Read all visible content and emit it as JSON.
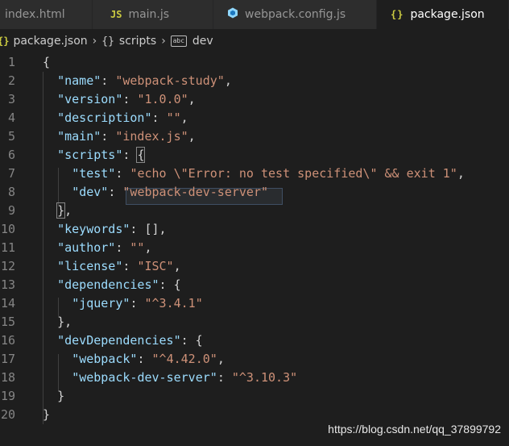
{
  "tabs": [
    {
      "label": "index.html",
      "icon": "html-file-icon"
    },
    {
      "label": "main.js",
      "icon": "js-file-icon",
      "icon_text": "JS"
    },
    {
      "label": "webpack.config.js",
      "icon": "webpack-cube-icon"
    },
    {
      "label": "package.json",
      "icon": "json-file-icon",
      "icon_text": "{}",
      "active": true
    }
  ],
  "breadcrumb": {
    "file": "package.json",
    "file_icon_text": "{}",
    "object_icon_text": "{}",
    "object": "scripts",
    "string_icon_text": "abc",
    "item": "dev"
  },
  "editor": {
    "lines": [
      {
        "n": "1",
        "parts": [
          [
            "p",
            "{"
          ]
        ]
      },
      {
        "n": "2",
        "parts": [
          [
            "k",
            "\"name\""
          ],
          [
            "p",
            ": "
          ],
          [
            "s",
            "\"webpack-study\""
          ],
          [
            "p",
            ","
          ]
        ]
      },
      {
        "n": "3",
        "parts": [
          [
            "k",
            "\"version\""
          ],
          [
            "p",
            ": "
          ],
          [
            "s",
            "\"1.0.0\""
          ],
          [
            "p",
            ","
          ]
        ]
      },
      {
        "n": "4",
        "parts": [
          [
            "k",
            "\"description\""
          ],
          [
            "p",
            ": "
          ],
          [
            "s",
            "\"\""
          ],
          [
            "p",
            ","
          ]
        ]
      },
      {
        "n": "5",
        "parts": [
          [
            "k",
            "\"main\""
          ],
          [
            "p",
            ": "
          ],
          [
            "s",
            "\"index.js\""
          ],
          [
            "p",
            ","
          ]
        ]
      },
      {
        "n": "6",
        "parts": [
          [
            "k",
            "\"scripts\""
          ],
          [
            "p",
            ": "
          ],
          [
            "p",
            "{"
          ]
        ]
      },
      {
        "n": "7",
        "parts": [
          [
            "k",
            "\"test\""
          ],
          [
            "p",
            ": "
          ],
          [
            "s",
            "\"echo \\\"Error: no test specified\\\" && exit 1\""
          ],
          [
            "p",
            ","
          ]
        ]
      },
      {
        "n": "8",
        "parts": [
          [
            "k",
            "\"dev\""
          ],
          [
            "p",
            ": "
          ],
          [
            "s",
            "\"webpack-dev-server\""
          ]
        ]
      },
      {
        "n": "9",
        "parts": [
          [
            "p",
            "}"
          ],
          [
            "p",
            ","
          ]
        ]
      },
      {
        "n": "10",
        "parts": [
          [
            "k",
            "\"keywords\""
          ],
          [
            "p",
            ": [],"
          ]
        ]
      },
      {
        "n": "11",
        "parts": [
          [
            "k",
            "\"author\""
          ],
          [
            "p",
            ": "
          ],
          [
            "s",
            "\"\""
          ],
          [
            "p",
            ","
          ]
        ]
      },
      {
        "n": "12",
        "parts": [
          [
            "k",
            "\"license\""
          ],
          [
            "p",
            ": "
          ],
          [
            "s",
            "\"ISC\""
          ],
          [
            "p",
            ","
          ]
        ]
      },
      {
        "n": "13",
        "parts": [
          [
            "k",
            "\"dependencies\""
          ],
          [
            "p",
            ": {"
          ]
        ]
      },
      {
        "n": "14",
        "parts": [
          [
            "k",
            "\"jquery\""
          ],
          [
            "p",
            ": "
          ],
          [
            "s",
            "\"^3.4.1\""
          ]
        ]
      },
      {
        "n": "15",
        "parts": [
          [
            "p",
            "},"
          ]
        ]
      },
      {
        "n": "16",
        "parts": [
          [
            "k",
            "\"devDependencies\""
          ],
          [
            "p",
            ": {"
          ]
        ]
      },
      {
        "n": "17",
        "parts": [
          [
            "k",
            "\"webpack\""
          ],
          [
            "p",
            ": "
          ],
          [
            "s",
            "\"^4.42.0\""
          ],
          [
            "p",
            ","
          ]
        ]
      },
      {
        "n": "18",
        "parts": [
          [
            "k",
            "\"webpack-dev-server\""
          ],
          [
            "p",
            ": "
          ],
          [
            "s",
            "\"^3.10.3\""
          ]
        ]
      },
      {
        "n": "19",
        "parts": [
          [
            "p",
            "}"
          ]
        ]
      },
      {
        "n": "20",
        "parts": [
          [
            "p",
            "}"
          ]
        ]
      }
    ]
  },
  "watermark": "https://blog.csdn.net/qq_37899792",
  "colors": {
    "editor_bg": "#1e1e1e",
    "tab_inactive_bg": "#2d2d2d",
    "key": "#9cdcfe",
    "string": "#ce9178",
    "punctuation": "#d4d4d4",
    "line_number": "#858585",
    "json_icon": "#cbcb41",
    "webpack_icon": "#8ed6fb"
  }
}
